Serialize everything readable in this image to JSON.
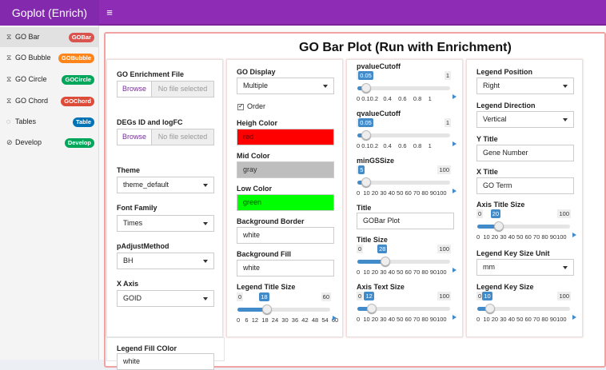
{
  "app": {
    "title": "Goplot (Enrich)",
    "menu_icon": "hamburger-icon"
  },
  "sidebar": {
    "items": [
      {
        "label": "GO Bar",
        "icon": "⧖",
        "badge": "GOBar",
        "color": "#d9534f",
        "active": true
      },
      {
        "label": "GO Bubble",
        "icon": "⧖",
        "badge": "GOBubble",
        "color": "#ff851b"
      },
      {
        "label": "GO Circle",
        "icon": "⧖",
        "badge": "GOCircle",
        "color": "#00a65a"
      },
      {
        "label": "GO Chord",
        "icon": "⧖",
        "badge": "GOChord",
        "color": "#dd4b39"
      },
      {
        "label": "Tables",
        "icon": "◌",
        "badge": "Table",
        "color": "#0073b7"
      },
      {
        "label": "Develop",
        "icon": "⊘",
        "badge": "Develop",
        "color": "#00a65a"
      }
    ]
  },
  "page": {
    "title": "GO Bar Plot (Run with Enrichment)"
  },
  "col1": {
    "go_file": {
      "label": "GO Enrichment File",
      "browse": "Browse",
      "placeholder": "No file selected"
    },
    "degs_file": {
      "label": "DEGs ID and logFC",
      "browse": "Browse",
      "placeholder": "No file selected"
    },
    "theme": {
      "label": "Theme",
      "value": "theme_default"
    },
    "font": {
      "label": "Font Family",
      "value": "Times"
    },
    "padjust": {
      "label": "pAdjustMethod",
      "value": "BH"
    },
    "xaxis": {
      "label": "X Axis",
      "value": "GOID"
    },
    "legend_fill": {
      "label": "Legend Fill COlor",
      "value": "white"
    }
  },
  "col2": {
    "display": {
      "label": "GO Display",
      "value": "Multiple"
    },
    "order": {
      "label": "Order",
      "checked": true
    },
    "high": {
      "label": "Heigh Color",
      "value": "red",
      "color": "#ff0000"
    },
    "mid": {
      "label": "Mid Color",
      "value": "gray",
      "color": "#bebebe"
    },
    "low": {
      "label": "Low Color",
      "value": "green",
      "color": "#00ff00"
    },
    "bg_border": {
      "label": "Background Border",
      "value": "white"
    },
    "bg_fill": {
      "label": "Background Fill",
      "value": "white"
    },
    "legend_title_size": {
      "label": "Legend Title Size",
      "min": "0",
      "max": "60",
      "value": "18",
      "fraction": 0.3,
      "ticks": "0   6  12  18  24  30  36  42  48  54  60"
    }
  },
  "col3": {
    "pvalue": {
      "label": "pvalueCutoff",
      "min": "0",
      "max": "1",
      "value": "0.05",
      "fraction": 0.05,
      "ticks": "0 0.10.2   0.4    0.6    0.8    1"
    },
    "qvalue": {
      "label": "qvalueCutoff",
      "min": "0",
      "max": "1",
      "value": "0.05",
      "fraction": 0.05,
      "ticks": "0 0.10.2   0.4    0.6    0.8    1"
    },
    "mings": {
      "label": "minGSSize",
      "min": "0",
      "max": "100",
      "value": "5",
      "fraction": 0.05,
      "ticks": "0  10 20 30 40 50 60 70 80 90100"
    },
    "title": {
      "label": "Title",
      "value": "GOBar Plot"
    },
    "title_size": {
      "label": "Title Size",
      "min": "0",
      "max": "100",
      "value": "28",
      "fraction": 0.28,
      "ticks": "0  10 20 30 40 50 60 70 80 90100"
    },
    "axis_text": {
      "label": "Axis Text Size",
      "min": "0",
      "max": "100",
      "value": "12",
      "fraction": 0.12,
      "ticks": "0  10 20 30 40 50 60 70 80 90100"
    }
  },
  "col4": {
    "legend_pos": {
      "label": "Legend Position",
      "value": "Right"
    },
    "legend_dir": {
      "label": "Legend Direction",
      "value": "Vertical"
    },
    "ytitle": {
      "label": "Y Title",
      "value": "Gene Number"
    },
    "xtitle": {
      "label": "X Title",
      "value": "GO Term"
    },
    "axis_title_size": {
      "label": "Axis Title Size",
      "min": "0",
      "max": "100",
      "value": "20",
      "fraction": 0.2,
      "ticks": "0  10 20 30 40 50 60 70 80 90100"
    },
    "key_unit": {
      "label": "Legend Key Size Unit",
      "value": "mm"
    },
    "key_size": {
      "label": "Legend Key Size",
      "min": "0",
      "max": "100",
      "value": "10",
      "fraction": 0.1,
      "ticks": "0  10 20 30 40 50 60 70 80 90100"
    }
  }
}
